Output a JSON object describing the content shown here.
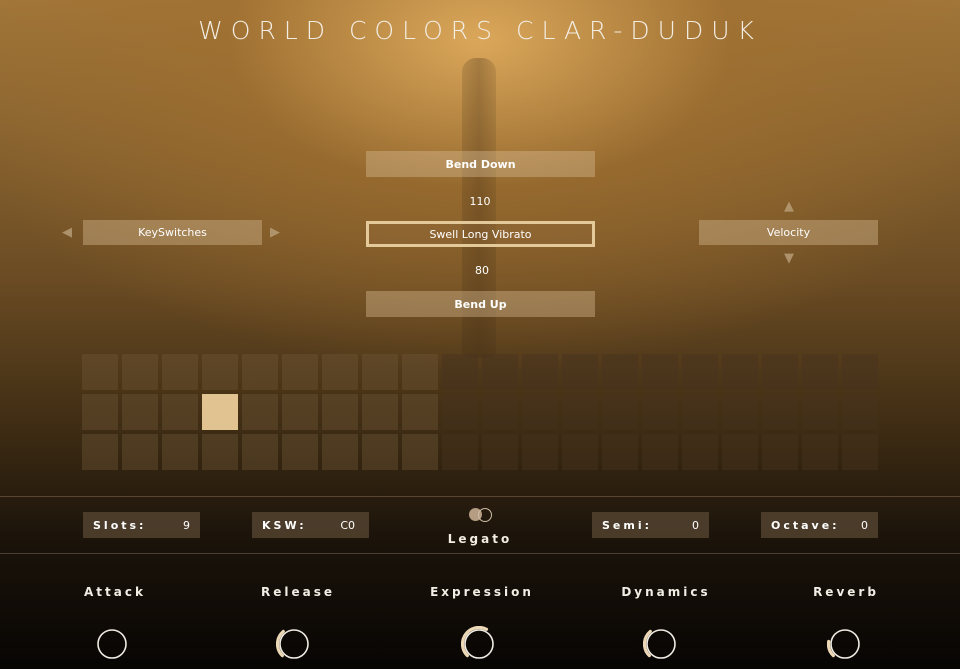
{
  "title": "WORLD COLORS CLAR-DUDUK",
  "articulation": {
    "bend_down": "Bend Down",
    "upper_value": "110",
    "selected": "Swell Long Vibrato",
    "lower_value": "80",
    "bend_up": "Bend Up"
  },
  "left_selector": {
    "label": "KeySwitches"
  },
  "right_selector": {
    "label": "Velocity"
  },
  "slot_grid": {
    "rows": 3,
    "columns": 20,
    "active_columns": 9,
    "selected_row": 2,
    "selected_column": 4
  },
  "settings": {
    "slots": {
      "label": "Slots:",
      "value": "9"
    },
    "ksw": {
      "label": "KSW:",
      "value": "C0"
    },
    "legato": {
      "label": "Legato"
    },
    "semi": {
      "label": "Semi:",
      "value": "0"
    },
    "octave": {
      "label": "Octave:",
      "value": "0"
    }
  },
  "knobs": [
    {
      "label": "Attack",
      "level": 0.0
    },
    {
      "label": "Release",
      "level": 0.35
    },
    {
      "label": "Expression",
      "level": 0.6
    },
    {
      "label": "Dynamics",
      "level": 0.35
    },
    {
      "label": "Reverb",
      "level": 0.2
    }
  ],
  "colors": {
    "accent": "#e1c392",
    "knob_ring": "#ecd8b6"
  }
}
